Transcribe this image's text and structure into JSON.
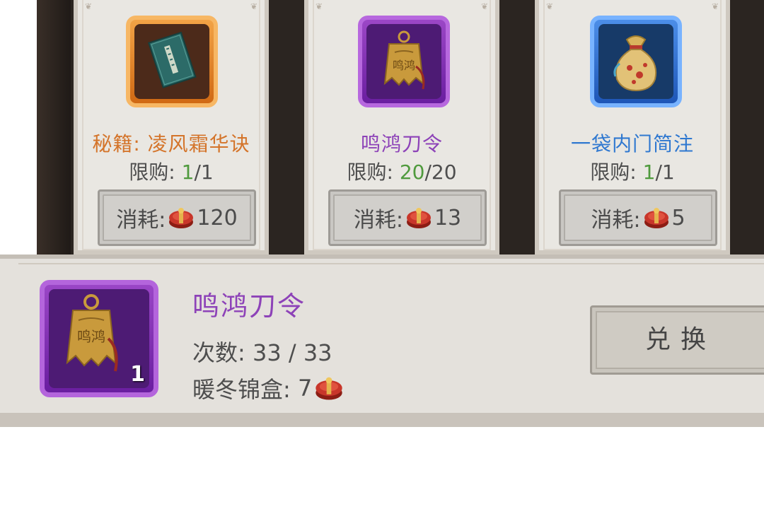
{
  "shop": {
    "items": [
      {
        "name": "秘籍: 凌风霜华诀",
        "name_color": "#d4742a",
        "limit_label": "限购: ",
        "limit_current": "1",
        "limit_total": "/1",
        "cost_label": "消耗:",
        "cost_value": "120",
        "rarity": "orange",
        "icon": "book-icon"
      },
      {
        "name": "鸣鸿刀令",
        "name_color": "#8d42b8",
        "limit_label": "限购: ",
        "limit_current": "20",
        "limit_total": "/20",
        "cost_label": "消耗:",
        "cost_value": "13",
        "rarity": "purple",
        "icon": "bell-token-icon"
      },
      {
        "name": "一袋内门简注",
        "name_color": "#2f78d0",
        "limit_label": "限购: ",
        "limit_current": "1",
        "limit_total": "/1",
        "cost_label": "消耗:",
        "cost_value": "5",
        "rarity": "blue",
        "icon": "cloth-bag-icon"
      }
    ],
    "currency_icon": "brocade-box-icon"
  },
  "detail": {
    "name": "鸣鸿刀令",
    "count": "1",
    "times_label": "次数:",
    "times_value": "33 / 33",
    "box_label": "暖冬锦盒:",
    "box_value": "7",
    "icon": "bell-token-icon",
    "exchange_label": "兑换"
  },
  "colors": {
    "orange": "#d4742a",
    "purple": "#8d42b8",
    "blue": "#2f78d0",
    "green": "#4f9a3d"
  }
}
